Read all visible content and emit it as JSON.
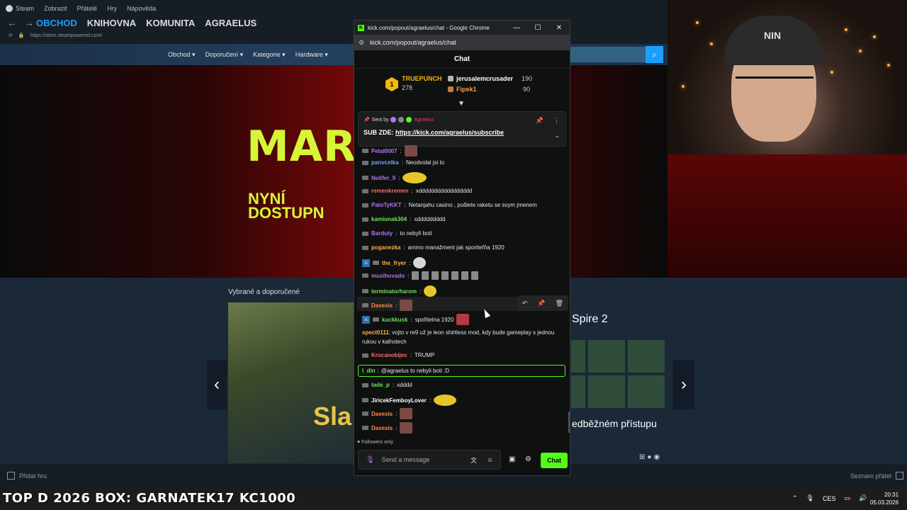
{
  "steam": {
    "menubar": [
      "Steam",
      "Zobrazit",
      "Přátelé",
      "Hry",
      "Nápověda"
    ],
    "nav_tabs": [
      "OBCHOD",
      "KNIHOVNA",
      "KOMUNITA",
      "AGRAELUS"
    ],
    "url": "https://store.steampowered.com/",
    "store_menu": [
      "Obchod",
      "Doporučení",
      "Kategorie",
      "Hardware"
    ],
    "banner": {
      "title": "MARAT",
      "sub1": "NYNÍ",
      "sub2": "DOSTUPN"
    },
    "featured_title": "Vybrané a doporučené",
    "game_art_text": "Sla",
    "game_title": "Spire 2",
    "game_access": "edběžném přístupu",
    "add_game": "Přidat hru",
    "friends_list": "Seznam přátel"
  },
  "chrome": {
    "title": "kick.com/popout/agraelus/chat - Google Chrome",
    "url": "kick.com/popout/agraelus/chat",
    "controls": [
      "—",
      "☐",
      "✕"
    ]
  },
  "chat": {
    "header": "Chat",
    "leaderboard": {
      "rank1": {
        "rank": "1",
        "name": "TRUEPUNCH",
        "score": "278"
      },
      "rank2": {
        "name": "jerusalemcrusader",
        "score": "190"
      },
      "rank3": {
        "name": "Fipek1",
        "score": "90"
      }
    },
    "pinned": {
      "sent_by": "Sent by",
      "author": "Agraelus",
      "prefix": "SUB ZDE: ",
      "link": "https://kick.com/agraelus/subscribe"
    },
    "messages": [
      {
        "user": "Pelal0007",
        "text": "",
        "color": "#b275f5"
      },
      {
        "user": "panvcelka",
        "text": " Neodvolal jsi to",
        "color": "#6da8ff"
      },
      {
        "user": "Nolifer_9",
        "text": "",
        "color": "#b275f5"
      },
      {
        "user": "remenkremen",
        "text": " xddddddddddddddddd",
        "color": "#ff6b6b"
      },
      {
        "user": "PatoTyKKT",
        "text": " Netanjahu casino , pošlete raketu se svym jmenem",
        "color": "#b275f5"
      },
      {
        "user": "kamionak304",
        "text": " xddddddddd",
        "color": "#72e25a"
      },
      {
        "user": "Barduty",
        "text": " to nebyli boti",
        "color": "#b275f5"
      },
      {
        "user": "poganezka",
        "text": " ammo manažment jak sporiteľňa 1920",
        "color": "#ffb347"
      },
      {
        "user": "the_fryer",
        "text": "",
        "color": "#ffb347"
      },
      {
        "user": "muxihovado",
        "text": "",
        "color": "#b275f5"
      },
      {
        "user": "terminatorharom",
        "text": "",
        "color": "#72e25a"
      },
      {
        "user": "Davexis",
        "text": "",
        "color": "#ff8c42"
      },
      {
        "user": "kuckkuck",
        "text": " spořitelna 1920",
        "color": "#72e25a"
      },
      {
        "user": "spect0111",
        "text": " vojto v re9 už je leon shirtless mod, kdy bude gameplay s jednou rukou v kalhotech",
        "color": "#ffb347"
      },
      {
        "user": "Krocanobijec",
        "text": " TRUMP",
        "color": "#ff6b6b"
      },
      {
        "user": "l_din",
        "text": " @agraelus to nebyli boti :D",
        "color": "#72e25a"
      },
      {
        "user": "tade_p",
        "text": " xdddd",
        "color": "#72e25a"
      },
      {
        "user": "JiricekFemboyLover",
        "text": "",
        "color": "#ffffff"
      },
      {
        "user": "Davexis",
        "text": "",
        "color": "#ff8c42"
      },
      {
        "user": "Davexis",
        "text": "",
        "color": "#ff8c42"
      }
    ],
    "followers_only": "Followers only",
    "input_placeholder": "Send a message",
    "send_button": "Chat"
  },
  "taskbar": {
    "ticker": "TOP D 2026 BOX: GARNATEK17 KC1000",
    "language": "CES",
    "time": "20:31",
    "date": "05.03.2026"
  },
  "webcam": {
    "cap_logo": "NIN"
  },
  "colors": {
    "kick_green": "#53fc18",
    "steam_blue": "#1a9fff",
    "banner_lime": "#d6f536"
  },
  "icons": [
    "steam-logo-icon",
    "back-icon",
    "forward-icon",
    "chevron-down-icon",
    "search-icon",
    "kick-icon",
    "minimize-icon",
    "maximize-icon",
    "close-icon",
    "pin-icon",
    "more-icon",
    "reply-icon",
    "delete-icon",
    "mic-icon",
    "emote-icon",
    "gift-icon",
    "gear-icon",
    "heart-icon"
  ]
}
